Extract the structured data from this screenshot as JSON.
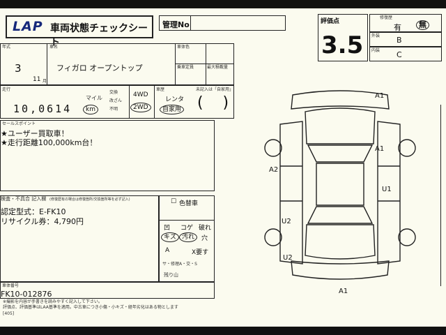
{
  "header": {
    "logo": "LAP",
    "title": "車両状態チェックシート",
    "mgmt_label": "管理No"
  },
  "evaluation": {
    "score_label": "評価点",
    "score": "3.5",
    "history_label": "修復歴",
    "history_yes": "有",
    "history_no": "無",
    "exterior_label": "外装",
    "exterior_grade": "B",
    "interior_label": "内装",
    "interior_grade": "C"
  },
  "vehicle": {
    "year_label": "年式",
    "year": "3",
    "month": "11",
    "month_suffix": "月",
    "name_label": "車名",
    "name": "フィガロ オープントップ",
    "color_label": "車体色",
    "seat_label": "乗車定員",
    "load_label": "最大積載量"
  },
  "mileage": {
    "label": "走行",
    "value": "10,0614",
    "unit_mile": "マイル",
    "unit_km": "km",
    "opt1": "交換",
    "opt2": "改ざん",
    "opt3": "不明",
    "drive_4wd": "4WD",
    "drive_2wd": "2WD",
    "type_label": "車歴",
    "type_rental": "レンタ",
    "type_private": "自家用",
    "unregistered_label": "未記入は「自家用」"
  },
  "sales": {
    "label": "セールスポイント",
    "line1": "★ユーザー買取車！",
    "line2": "★走行距離100,000km台！"
  },
  "notes": {
    "label": "検査・不具合 記入欄",
    "sub_label": "(修復歴有の場合は修復箇所/交換箇所等を必ず記入)",
    "line1": "認定型式：E-FK10",
    "line2": "リサイクル券：4,790円"
  },
  "paint": {
    "repaint_label": "色替車",
    "symbols_row1": [
      "凹",
      "コゲ",
      "破れ"
    ],
    "symbols_row2": [
      "キズ",
      "汚れ",
      "穴"
    ],
    "symbols_row3": [
      "A",
      "X要す"
    ],
    "row4": "サ・修理A・交・S",
    "row5": "残り山"
  },
  "chassis": {
    "label": "車体番号",
    "value": "FK10-012876"
  },
  "footer": {
    "line1": "※撮影を内容が手書きを読みやすく記入して下さい。",
    "line2": "評価点、評価基準はLAA基準を適用。中古車につき小傷・小キズ・経年劣化はある物とします",
    "code": "[405]"
  },
  "diagram_marks": [
    "A1",
    "A1",
    "A2",
    "U1",
    "U2",
    "U2",
    "A1"
  ]
}
